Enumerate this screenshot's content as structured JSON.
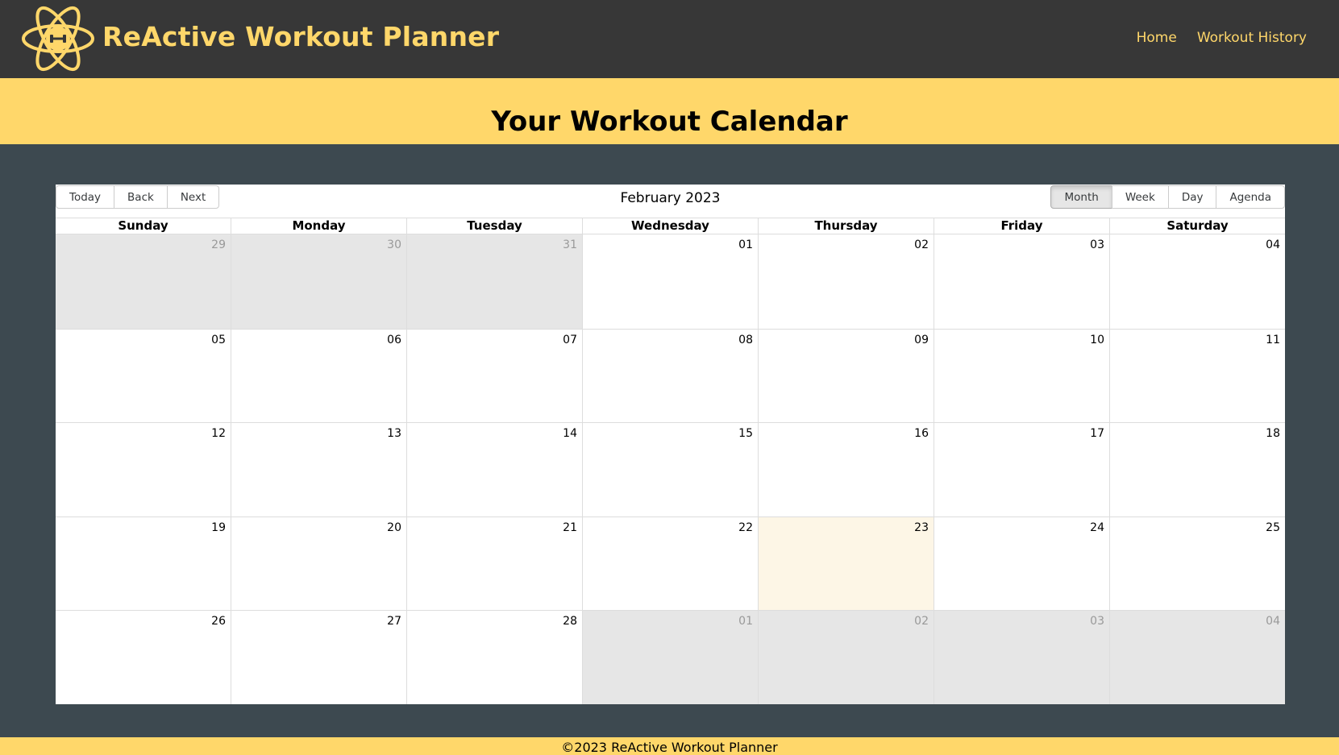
{
  "header": {
    "app_title": "ReActive Workout Planner",
    "nav": [
      {
        "label": "Home"
      },
      {
        "label": "Workout History"
      }
    ],
    "logo_icon": "atom-dumbbell-icon"
  },
  "banner": {
    "title": "Your Workout Calendar"
  },
  "calendar": {
    "nav_buttons": [
      "Today",
      "Back",
      "Next"
    ],
    "label": "February 2023",
    "view_buttons": [
      "Month",
      "Week",
      "Day",
      "Agenda"
    ],
    "active_view": "Month",
    "weekdays": [
      "Sunday",
      "Monday",
      "Tuesday",
      "Wednesday",
      "Thursday",
      "Friday",
      "Saturday"
    ],
    "weeks": [
      [
        {
          "d": "29",
          "off": true
        },
        {
          "d": "30",
          "off": true
        },
        {
          "d": "31",
          "off": true
        },
        {
          "d": "01"
        },
        {
          "d": "02"
        },
        {
          "d": "03"
        },
        {
          "d": "04"
        }
      ],
      [
        {
          "d": "05"
        },
        {
          "d": "06"
        },
        {
          "d": "07"
        },
        {
          "d": "08"
        },
        {
          "d": "09"
        },
        {
          "d": "10"
        },
        {
          "d": "11"
        }
      ],
      [
        {
          "d": "12"
        },
        {
          "d": "13"
        },
        {
          "d": "14"
        },
        {
          "d": "15"
        },
        {
          "d": "16"
        },
        {
          "d": "17"
        },
        {
          "d": "18"
        }
      ],
      [
        {
          "d": "19"
        },
        {
          "d": "20"
        },
        {
          "d": "21"
        },
        {
          "d": "22"
        },
        {
          "d": "23",
          "today": true
        },
        {
          "d": "24"
        },
        {
          "d": "25"
        }
      ],
      [
        {
          "d": "26"
        },
        {
          "d": "27"
        },
        {
          "d": "28"
        },
        {
          "d": "01",
          "off": true
        },
        {
          "d": "02",
          "off": true
        },
        {
          "d": "03",
          "off": true
        },
        {
          "d": "04",
          "off": true
        }
      ]
    ]
  },
  "footer": {
    "text": "©2023 ReActive Workout Planner"
  },
  "colors": {
    "header_bg": "#373737",
    "accent": "#ffd76a",
    "page_bg": "#3d4950",
    "off_range_bg": "#e6e6e6",
    "today_bg": "#fdf6e6"
  }
}
